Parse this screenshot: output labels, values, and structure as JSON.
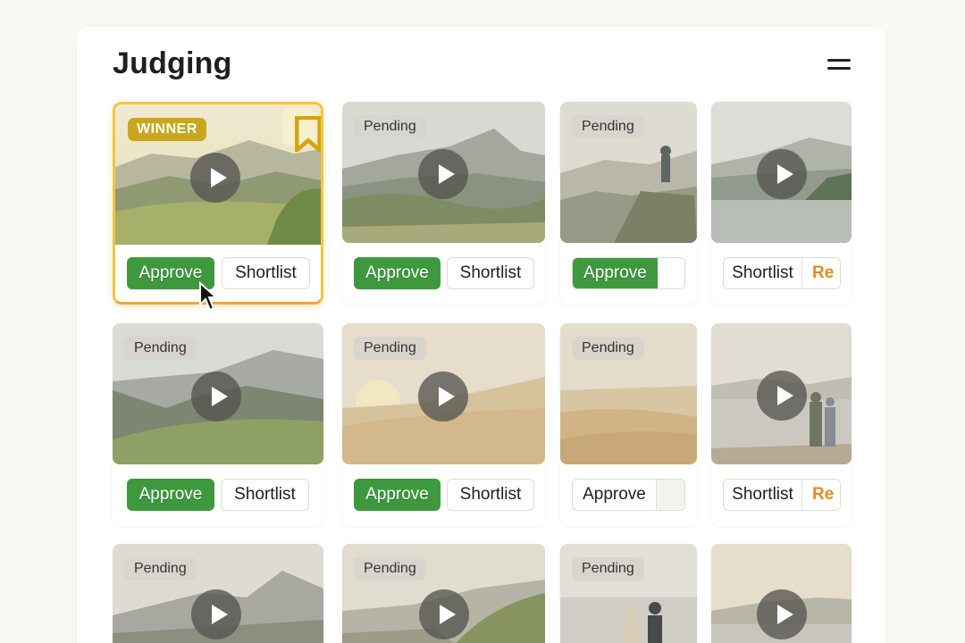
{
  "page": {
    "title": "Judging"
  },
  "labels": {
    "approve": "Approve",
    "shortlist": "Shortlist",
    "reject_partial": "Re",
    "pending": "Pending",
    "winner": "WINNER"
  },
  "colors": {
    "approve_green": "#3e993e",
    "winner_gold": "#c9a61d",
    "winner_border": "#f4c43f",
    "reject_orange": "#e58a1f"
  },
  "icons": {
    "menu": "hamburger-menu-icon",
    "play": "play-icon",
    "bookmark": "bookmark-icon",
    "cursor": "mouse-pointer-icon"
  },
  "grid": [
    {
      "status": "WINNER",
      "scene": "green-hills",
      "buttons": [
        "Approve",
        "Shortlist"
      ]
    },
    {
      "status": "Pending",
      "scene": "mountain-peak",
      "buttons": [
        "Approve",
        "Shortlist"
      ]
    },
    {
      "status": "Pending",
      "scene": "person-on-rock",
      "buttons": [
        "Approve"
      ]
    },
    {
      "status": "",
      "scene": "mountain-lake",
      "buttons": [
        "Shortlist",
        "Re"
      ]
    },
    {
      "status": "Pending",
      "scene": "valley-hills",
      "buttons": [
        "Approve",
        "Shortlist"
      ]
    },
    {
      "status": "Pending",
      "scene": "desert-sunrise",
      "buttons": [
        "Approve",
        "Shortlist"
      ]
    },
    {
      "status": "Pending",
      "scene": "desert-dunes",
      "buttons": [
        "Approve"
      ]
    },
    {
      "status": "",
      "scene": "couple-coast",
      "buttons": [
        "Shortlist",
        "Re"
      ]
    },
    {
      "status": "Pending",
      "scene": "sunset-peaks",
      "buttons": []
    },
    {
      "status": "Pending",
      "scene": "coastal-cliff",
      "buttons": []
    },
    {
      "status": "Pending",
      "scene": "couple-sea",
      "buttons": []
    },
    {
      "status": "",
      "scene": "sunset-lake",
      "buttons": []
    }
  ]
}
